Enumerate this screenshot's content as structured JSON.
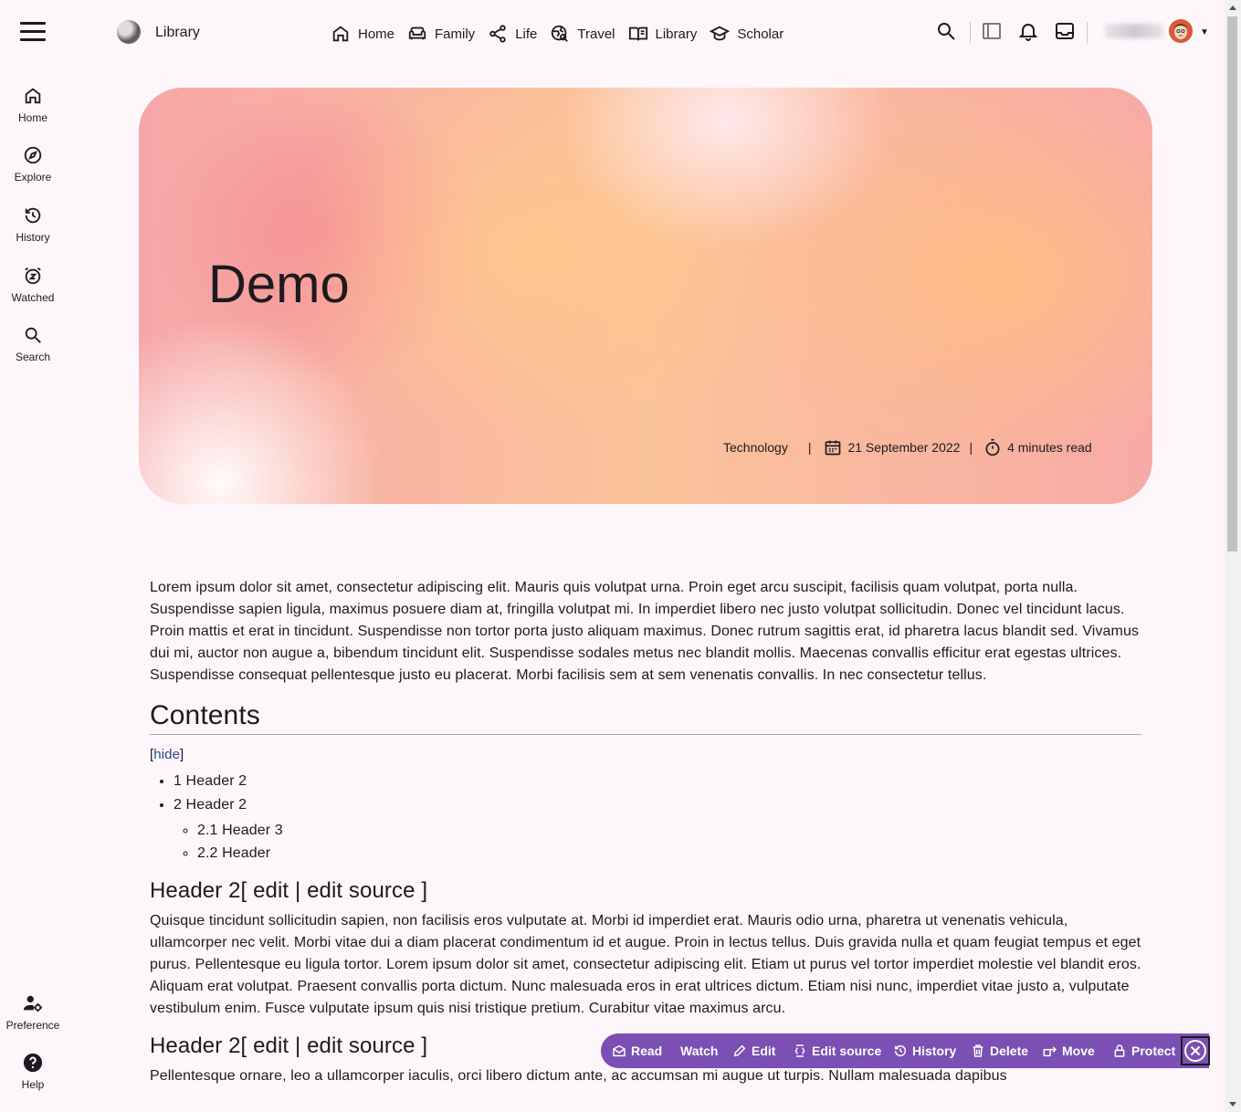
{
  "header": {
    "site_title": "Library",
    "nav": [
      {
        "label": "Home",
        "icon": "home-icon"
      },
      {
        "label": "Family",
        "icon": "sofa-icon"
      },
      {
        "label": "Life",
        "icon": "share-icon"
      },
      {
        "label": "Travel",
        "icon": "travel-globe-icon"
      },
      {
        "label": "Library",
        "icon": "book-icon"
      },
      {
        "label": "Scholar",
        "icon": "graduation-cap-icon"
      }
    ],
    "right_icons": [
      "search-icon",
      "sidebar-panel-icon",
      "bell-icon",
      "inbox-icon"
    ]
  },
  "rail": {
    "items": [
      {
        "label": "Home",
        "icon": "home-icon"
      },
      {
        "label": "Explore",
        "icon": "compass-icon"
      },
      {
        "label": "History",
        "icon": "history-icon"
      },
      {
        "label": "Watched",
        "icon": "alarm-icon"
      },
      {
        "label": "Search",
        "icon": "search-icon"
      }
    ],
    "bottom": [
      {
        "label": "Preference",
        "icon": "user-settings-icon"
      },
      {
        "label": "Help",
        "icon": "help-icon"
      }
    ]
  },
  "hero": {
    "title": "Demo",
    "category": "Technology",
    "date": "21 September 2022",
    "read_time": "4 minutes read"
  },
  "article": {
    "intro": "Lorem ipsum dolor sit amet, consectetur adipiscing elit. Mauris quis volutpat urna. Proin eget arcu suscipit, facilisis quam volutpat, porta nulla. Suspendisse sapien ligula, maximus posuere diam at, fringilla volutpat mi. In imperdiet libero nec justo volutpat sollicitudin. Donec vel tincidunt lacus. Proin mattis et erat in tincidunt. Suspendisse non tortor porta justo aliquam maximus. Donec rutrum sagittis erat, id pharetra lacus blandit sed. Vivamus dui mi, auctor non augue a, bibendum tincidunt elit. Suspendisse sodales metus nec blandit mollis. Maecenas convallis efficitur erat egestas ultrices. Suspendisse consequat pellentesque justo eu placerat. Morbi facilisis sem at sem venenatis convallis. In nec consectetur tellus.",
    "contents_heading": "Contents",
    "hide_label": "hide",
    "toc": [
      {
        "label": "1 Header 2"
      },
      {
        "label": "2 Header 2",
        "children": [
          "2.1 Header 3",
          "2.2 Header"
        ]
      }
    ],
    "sections": [
      {
        "heading": "Header 2",
        "edit": "edit",
        "edit_source": "edit source",
        "body": "Quisque tincidunt sollicitudin sapien, non facilisis eros vulputate at. Morbi id imperdiet erat. Mauris odio urna, pharetra ut venenatis vehicula, ullamcorper nec velit. Morbi vitae dui a diam placerat condimentum id et augue. Proin in lectus tellus. Duis gravida nulla et quam feugiat tempus et eget purus. Pellentesque eu ligula tortor. Lorem ipsum dolor sit amet, consectetur adipiscing elit. Etiam ut purus vel tortor imperdiet molestie vel blandit eros. Aliquam erat volutpat. Praesent convallis porta dictum. Nunc malesuada eros in erat ultrices dictum. Etiam nisi nunc, imperdiet vitae justo a, vulputate vestibulum enim. Fusce vulputate ipsum quis nisi tristique pretium. Curabitur vitae maximus arcu."
      },
      {
        "heading": "Header 2",
        "edit": "edit",
        "edit_source": "edit source",
        "body": "Pellentesque ornare, leo a ullamcorper iaculis, orci libero dictum ante, ac accumsan mi augue ut turpis. Nullam malesuada dapibus"
      }
    ]
  },
  "actions": {
    "read": "Read",
    "watch": "Watch",
    "edit": "Edit",
    "edit_source": "Edit source",
    "history": "History",
    "delete": "Delete",
    "move": "Move",
    "protect": "Protect"
  },
  "colors": {
    "background": "#fdf7fb",
    "action_bar": "#7b4fb3",
    "link": "#2c4a8a"
  }
}
